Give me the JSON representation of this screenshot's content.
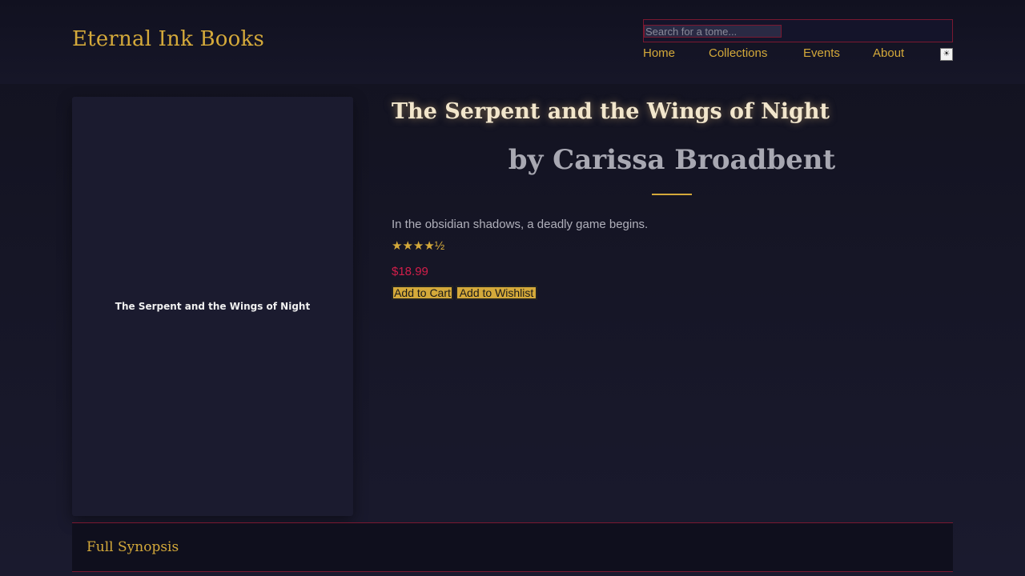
{
  "header": {
    "logo": "Eternal Ink Books",
    "search_placeholder": "Search for a tome...",
    "nav": [
      "Home",
      "Collections",
      "Events",
      "About"
    ],
    "theme_toggle": "☀"
  },
  "book": {
    "cover_title": "The Serpent and the Wings of Night",
    "title": "The Serpent and the Wings of Night",
    "author": "by Carissa Broadbent",
    "tagline": "In the obsidian shadows, a deadly game begins.",
    "rating": "★★★★½",
    "price": "$18.99",
    "add_to_cart": "Add to Cart",
    "add_to_wishlist": "Add to Wishlist"
  },
  "synopsis": {
    "label": "Full Synopsis"
  },
  "colors": {
    "accent_gold": "#d4a93a",
    "price_red": "#d21e4a",
    "border_crimson": "#7a1830",
    "background": "#1a1a2e"
  }
}
